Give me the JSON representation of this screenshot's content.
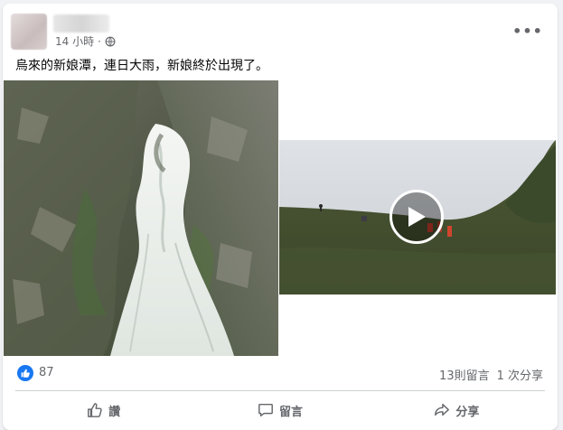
{
  "post": {
    "timestamp": "14 小時",
    "separator": "·",
    "text": "烏來的新娘潭，連日大雨，新娘終於出現了。",
    "more_label": "•••"
  },
  "stats": {
    "likes": "87",
    "comments": "13則留言",
    "shares": "1 次分享"
  },
  "actions": {
    "like": "讚",
    "comment": "留言",
    "share": "分享"
  },
  "colors": {
    "accent": "#1877f2",
    "secondary_text": "#65676b",
    "background": "#f0f2f5"
  },
  "icons": {
    "like_badge": "thumbs-up-icon",
    "privacy": "globe-icon",
    "like_action": "thumbs-up-outline-icon",
    "comment_action": "speech-bubble-icon",
    "share_action": "share-arrow-icon",
    "play": "play-icon"
  }
}
